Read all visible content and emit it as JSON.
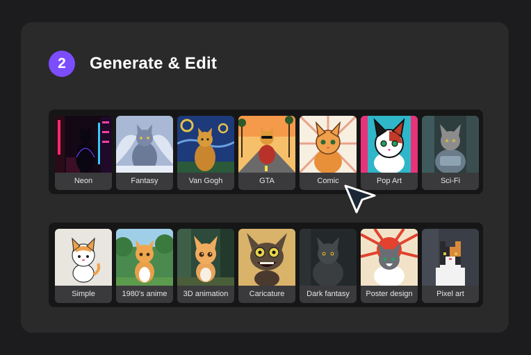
{
  "header": {
    "step_number": "2",
    "title": "Generate & Edit"
  },
  "styles_row1": [
    {
      "label": "Neon"
    },
    {
      "label": "Fantasy"
    },
    {
      "label": "Van Gogh"
    },
    {
      "label": "GTA"
    },
    {
      "label": "Comic"
    },
    {
      "label": "Pop Art"
    },
    {
      "label": "Sci-Fi"
    }
  ],
  "styles_row2": [
    {
      "label": "Simple"
    },
    {
      "label": "1980's anime"
    },
    {
      "label": "3D animation"
    },
    {
      "label": "Caricature"
    },
    {
      "label": "Dark fantasy"
    },
    {
      "label": "Poster design"
    },
    {
      "label": "Pixel art"
    }
  ],
  "colors": {
    "accent": "#7c4dff",
    "panel": "#2a2a2b",
    "row": "#161617",
    "card": "#3a3a3c",
    "cursor_fill": "#1b2636"
  },
  "icons": {
    "cursor": "arrow-pointer-icon"
  }
}
